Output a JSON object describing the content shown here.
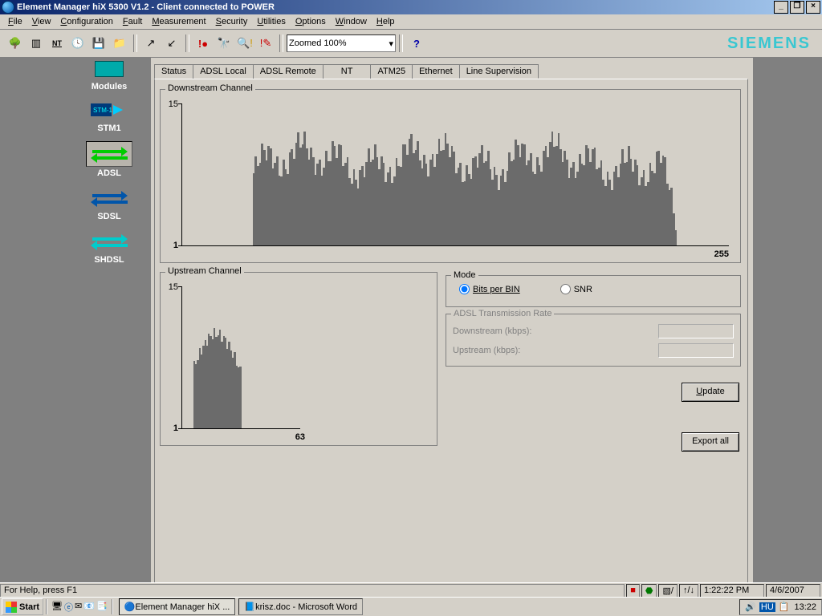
{
  "title": "Element Manager hiX 5300 V1.2 - Client connected to POWER",
  "menu": [
    "File",
    "View",
    "Configuration",
    "Fault",
    "Measurement",
    "Security",
    "Utilities",
    "Options",
    "Window",
    "Help"
  ],
  "zoom": "Zoomed 100%",
  "brand": "SIEMENS",
  "modules_header": "Modules",
  "modules": [
    {
      "id": "stm1",
      "label": "STM1"
    },
    {
      "id": "adsl",
      "label": "ADSL",
      "selected": true
    },
    {
      "id": "sdsl",
      "label": "SDSL"
    },
    {
      "id": "shdsl",
      "label": "SHDSL"
    }
  ],
  "tabs": [
    "Status",
    "ADSL Local",
    "ADSL Remote",
    "NT",
    "ATM25",
    "Ethernet",
    "Line Supervision"
  ],
  "active_tab": "Line Supervision",
  "downstream": {
    "title": "Downstream Channel",
    "ymin": "1",
    "ymax": "15",
    "xmax": "255"
  },
  "upstream": {
    "title": "Upstream Channel",
    "ymin": "1",
    "ymax": "15",
    "xmax": "63"
  },
  "mode": {
    "title": "Mode",
    "opt1": "Bits per BIN",
    "opt2": "SNR"
  },
  "rate": {
    "title": "ADSL Transmission Rate",
    "down": "Downstream (kbps):",
    "up": "Upstream (kbps):"
  },
  "buttons": {
    "update": "Update",
    "export": "Export all"
  },
  "status": {
    "help": "For Help, press F1",
    "time": "1:22:22 PM",
    "date": "4/6/2007"
  },
  "taskbar": {
    "start": "Start",
    "app1": "Element Manager hiX ...",
    "app2": "krisz.doc - Microsoft Word",
    "lang": "HU",
    "clock": "13:22"
  },
  "chart_data": [
    {
      "type": "bar",
      "name": "downstream",
      "xlabel": "",
      "ylabel": "",
      "title": "Downstream Channel",
      "x_range": [
        1,
        255
      ],
      "ylim": [
        1,
        15
      ],
      "note": "Bits-per-BIN allocation. Bins ~1-32 empty (upstream band). Bins ~33-205 carry 6-11 bits with local variation; falls off to 0 after ~230."
    },
    {
      "type": "bar",
      "name": "upstream",
      "xlabel": "",
      "ylabel": "",
      "title": "Upstream Channel",
      "x_range": [
        1,
        63
      ],
      "ylim": [
        1,
        15
      ],
      "note": "Bits-per-BIN allocation. Bins ~6-31 carry 1-10 bits in a hump peaking ~10 around bin 16-20; 0 elsewhere."
    }
  ]
}
